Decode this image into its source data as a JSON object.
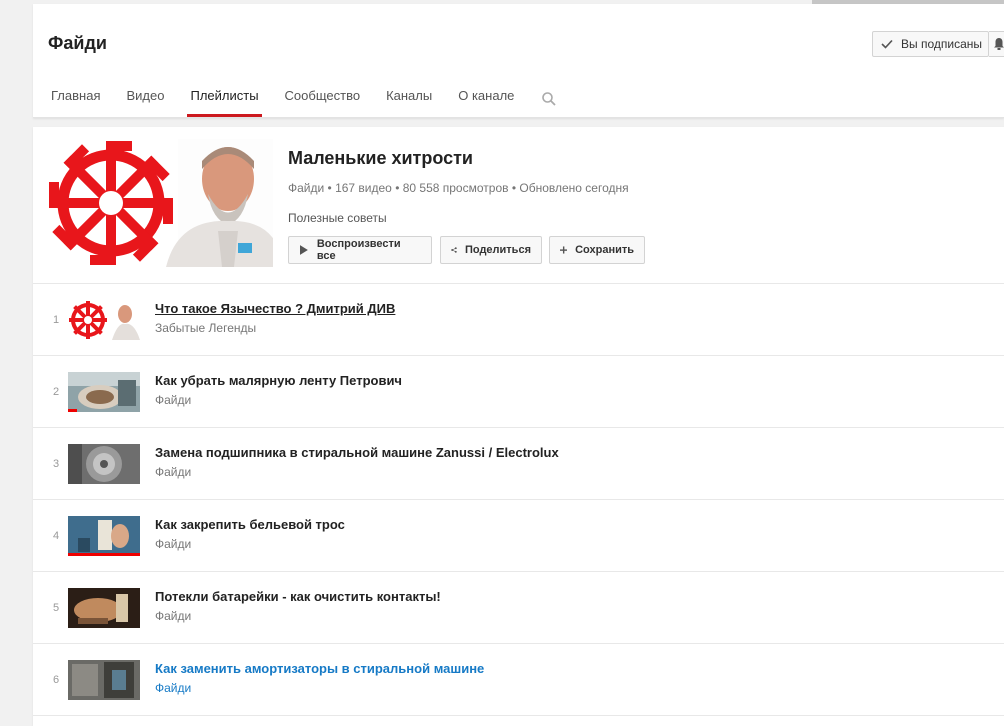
{
  "header": {
    "channel_title": "Файди",
    "subscribe_label": "Вы подписаны",
    "tabs": [
      {
        "label": "Главная",
        "active": false
      },
      {
        "label": "Видео",
        "active": false
      },
      {
        "label": "Плейлисты",
        "active": true
      },
      {
        "label": "Сообщество",
        "active": false
      },
      {
        "label": "Каналы",
        "active": false
      },
      {
        "label": "О канале",
        "active": false
      }
    ],
    "search_icon": "search-icon"
  },
  "playlist": {
    "title": "Маленькие хитрости",
    "meta": "Файди • 167 видео • 80 558 просмотров • Обновлено сегодня",
    "description": "Полезные советы",
    "play_all_label": "Воспроизвести все",
    "share_label": "Поделиться",
    "save_label": "Сохранить"
  },
  "videos": [
    {
      "index": "1",
      "title": "Что такое Язычество ? Дмитрий ДИВ",
      "owner": "Забытые Легенды"
    },
    {
      "index": "2",
      "title": "Как убрать малярную ленту Петрович",
      "owner": "Файди",
      "watched_fraction": 0.12
    },
    {
      "index": "3",
      "title": "Замена подшипника в стиральной машине Zanussi / Electrolux",
      "owner": "Файди"
    },
    {
      "index": "4",
      "title": "Как закрепить бельевой трос",
      "owner": "Файди",
      "watched_fraction": 1.0
    },
    {
      "index": "5",
      "title": "Потекли батарейки - как очистить контакты!",
      "owner": "Файди"
    },
    {
      "index": "6",
      "title": "Как заменить амортизаторы в стиральной машине",
      "owner": "Файди"
    }
  ],
  "colors": {
    "accent_red": "#cc181e",
    "link_blue": "#167ac6",
    "symbol_red": "#e8161b"
  }
}
